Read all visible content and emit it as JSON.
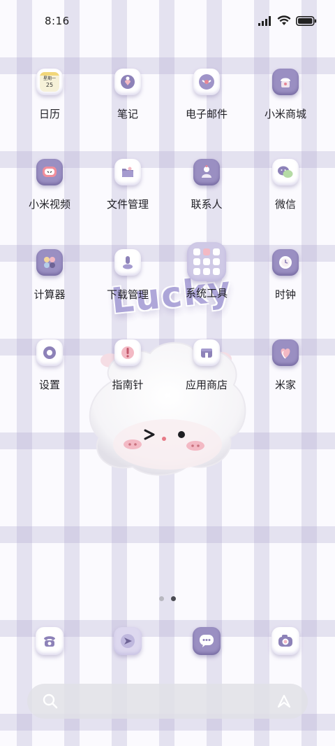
{
  "status_bar": {
    "time": "8:16"
  },
  "apps": [
    {
      "label": "日历",
      "icon": "calendar-icon",
      "badge_line1": "星期一",
      "badge_line2": "25"
    },
    {
      "label": "笔记",
      "icon": "notes-icon"
    },
    {
      "label": "电子邮件",
      "icon": "email-icon"
    },
    {
      "label": "小米商城",
      "icon": "mi-store-icon"
    },
    {
      "label": "小米视频",
      "icon": "mi-video-icon"
    },
    {
      "label": "文件管理",
      "icon": "file-manager-icon"
    },
    {
      "label": "联系人",
      "icon": "contacts-icon"
    },
    {
      "label": "微信",
      "icon": "wechat-icon"
    },
    {
      "label": "计算器",
      "icon": "calculator-icon"
    },
    {
      "label": "下载管理",
      "icon": "download-manager-icon"
    },
    {
      "label": "系统工具",
      "icon": "system-tools-folder-icon"
    },
    {
      "label": "时钟",
      "icon": "clock-icon"
    },
    {
      "label": "设置",
      "icon": "settings-icon"
    },
    {
      "label": "指南针",
      "icon": "compass-icon"
    },
    {
      "label": "应用商店",
      "icon": "app-store-icon"
    },
    {
      "label": "米家",
      "icon": "mi-home-icon"
    }
  ],
  "decoration": {
    "text": "Lucky"
  },
  "page_indicator": {
    "total": 2,
    "current": 2
  },
  "dock": [
    {
      "icon": "phone-icon"
    },
    {
      "icon": "browser-icon"
    },
    {
      "icon": "messages-icon"
    },
    {
      "icon": "camera-icon"
    }
  ],
  "colors": {
    "accent": "#9a8fc2",
    "grid_stripe": "#aaa2cd",
    "background": "#fbfafe"
  }
}
